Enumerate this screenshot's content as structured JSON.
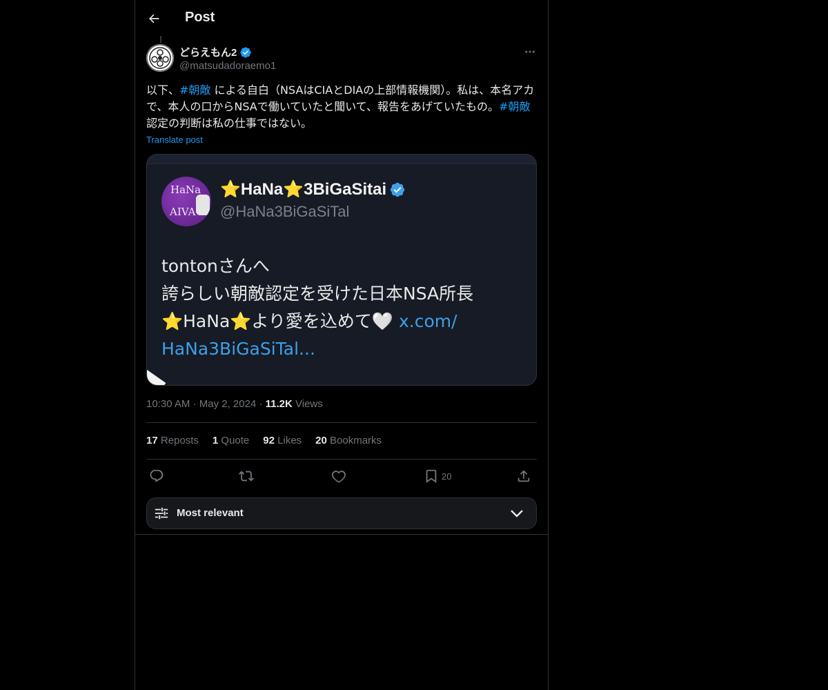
{
  "header": {
    "title": "Post"
  },
  "post": {
    "author_name": "どらえもん2",
    "author_handle": "@matsudadoraemo1",
    "text_parts": {
      "p1": "以下、",
      "tag1": "#朝敵",
      "p2": " による自白（NSAはCIAとDIAの上部情報機関）。私は、本名アカで、本人の口からNSAで働いていたと聞いて、報告をあげていたもの。",
      "tag2": "#朝敵",
      "p3": " 認定の判断は私の仕事ではない。"
    },
    "translate_label": "Translate post",
    "media": {
      "avatar_text_1": "HaNa",
      "avatar_text_2": "AIVA",
      "name": "⭐HaNa⭐3BiGaSitai",
      "handle": "@HaNa3BiGaSiTal",
      "line1": "tontonさんへ",
      "line2": "誇らしい朝敵認定を受けた日本NSA所長",
      "line3_text": "⭐HaNa⭐より愛を込めて🤍 ",
      "line3_link": "x.com/",
      "line4_link": "HaNa3BiGaSiTal..."
    },
    "time": "10:30 AM",
    "date": "May 2, 2024",
    "views_count": "11.2K",
    "views_label": "Views",
    "stats": {
      "reposts_count": "17",
      "reposts_label": "Reposts",
      "quotes_count": "1",
      "quotes_label": "Quote",
      "likes_count": "92",
      "likes_label": "Likes",
      "bookmarks_count": "20",
      "bookmarks_label": "Bookmarks"
    },
    "actions": {
      "bookmark_count": "20"
    }
  },
  "sort": {
    "label": "Most relevant"
  },
  "colors": {
    "accent": "#1d9bf0",
    "background": "#000000",
    "muted": "#71767b"
  },
  "icons": [
    "back-arrow-icon",
    "verified-badge-icon",
    "more-icon",
    "reply-icon",
    "repost-icon",
    "like-icon",
    "bookmark-icon",
    "share-icon",
    "sliders-icon",
    "chevron-down-icon"
  ]
}
